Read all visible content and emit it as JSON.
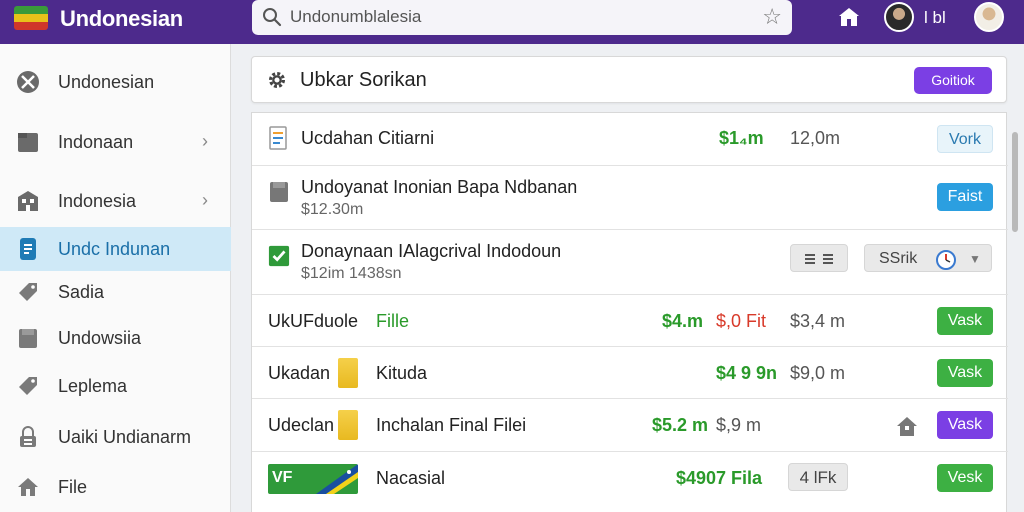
{
  "header": {
    "app_title": "Undonesian",
    "search": {
      "value": "Undonumblalesia",
      "placeholder": ""
    },
    "user_text": "l bl",
    "colors": {
      "topbar": "#4d2a8c",
      "accent": "#7b3fe4"
    }
  },
  "sidebar": {
    "items": [
      {
        "label": "Undonesian",
        "icon": "globe-icon"
      },
      {
        "label": "Indonaan",
        "icon": "folder-icon"
      },
      {
        "label": "Indonesia",
        "icon": "building-icon"
      },
      {
        "label": "Undc Indunan",
        "icon": "document-icon",
        "active": true
      },
      {
        "label": "Sadia",
        "icon": "tag-icon"
      },
      {
        "label": "Undowsiia",
        "icon": "file-icon"
      },
      {
        "label": "Leplema",
        "icon": "tag-icon"
      },
      {
        "label": "Uaiki Undianarm",
        "icon": "lock-icon"
      },
      {
        "label": "File",
        "icon": "home-icon"
      }
    ]
  },
  "panel": {
    "title": "Ubkar Sorikan",
    "button_label": "Goitiok"
  },
  "rows": [
    {
      "title": "Ucdahan Citiarni",
      "green": "$1₄m",
      "gray": "12,0m",
      "button": "Vork"
    },
    {
      "title": "Undoyanat Inonian Bapa Ndbanan",
      "sub": "$12.30m",
      "button": "Faist"
    },
    {
      "title": "Donaynaan IAlagcrival Indodoun",
      "sub": "$12im 1438sn",
      "button": "SSrik"
    },
    {
      "title": "UkUFduole",
      "file_label": "Fille",
      "green": "$4.m",
      "red": "$,0 Fit",
      "gray": "$3,4 m",
      "button": "Vask"
    },
    {
      "title": "Ukadan",
      "file_label": "Kituda",
      "green": "$4 9 9n",
      "gray": "$9,0 m",
      "button": "Vask"
    },
    {
      "title": "Udeclan",
      "file_label": "Inchalan Final Filei",
      "green": "$5.2 m",
      "gray": "$,9 m",
      "button": "Vask"
    },
    {
      "title": "Nacasial",
      "green": "$4907 Fila",
      "chip": "4 lFk",
      "button": "Vesk",
      "badge": "VF"
    }
  ]
}
